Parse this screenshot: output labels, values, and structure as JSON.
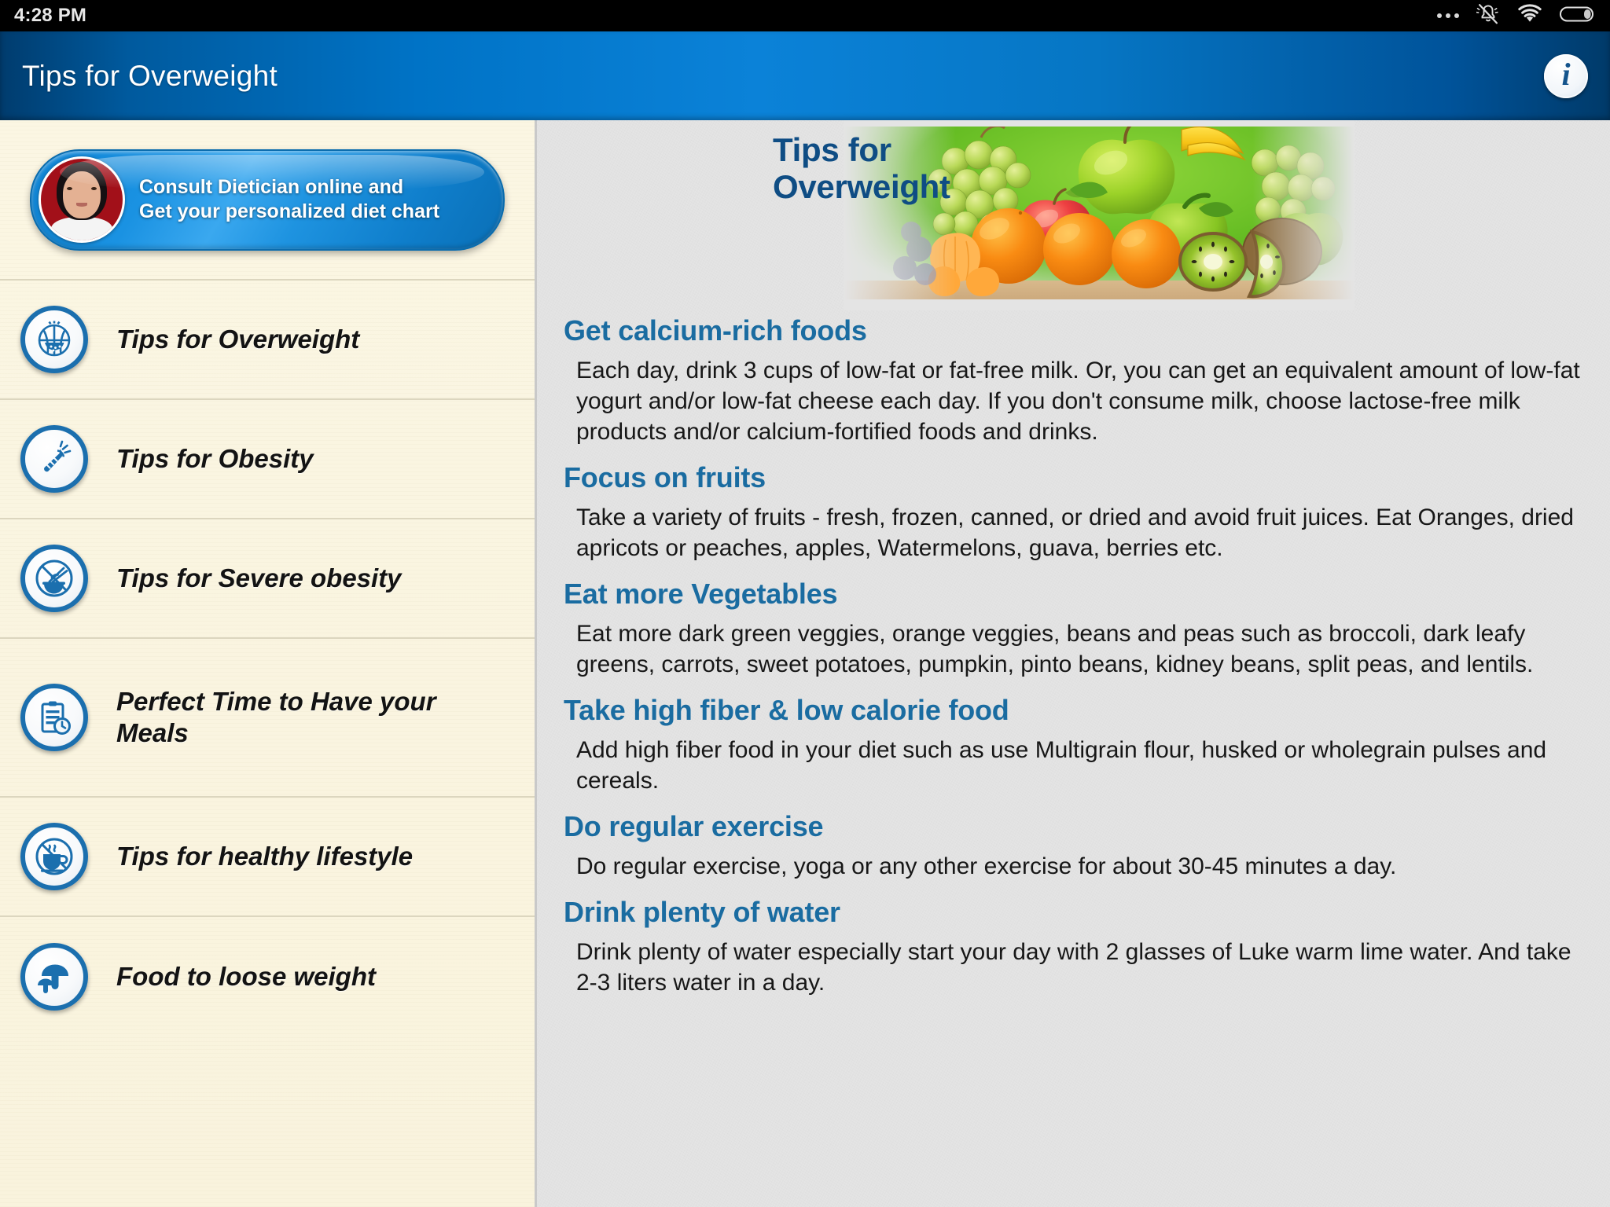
{
  "statusbar": {
    "time": "4:28 PM",
    "icons": [
      "more-dots-icon",
      "vibrate-off-icon",
      "wifi-icon",
      "battery-icon"
    ]
  },
  "appbar": {
    "title": "Tips for Overweight",
    "info_icon": "info-icon",
    "info_label": "i"
  },
  "sidebar": {
    "banner": {
      "line1": "Consult Dietician online and",
      "line2": "Get your personalized diet chart",
      "avatar": "dietician-photo"
    },
    "items": [
      {
        "label": "Tips for Overweight",
        "icon": "watermelon-icon"
      },
      {
        "label": "Tips for Obesity",
        "icon": "carrot-icon"
      },
      {
        "label": "Tips for Severe obesity",
        "icon": "no-noodles-icon"
      },
      {
        "label": "Perfect Time to Have your Meals",
        "icon": "clipboard-clock-icon"
      },
      {
        "label": "Tips for healthy lifestyle",
        "icon": "no-coffee-icon"
      },
      {
        "label": "Food to loose weight",
        "icon": "mushroom-icon"
      }
    ]
  },
  "main": {
    "hero": {
      "title": "Tips for\nOverweight",
      "image": "assorted-fruits-photo"
    },
    "sections": [
      {
        "heading": "Get calcium-rich foods",
        "body": "Each day, drink 3 cups of low-fat or fat-free milk. Or, you can get an equivalent amount of low-fat yogurt and/or low-fat cheese each day. If you don't consume milk, choose lactose-free milk products and/or calcium-fortified foods and drinks."
      },
      {
        "heading": "Focus on fruits",
        "body": "Take a variety of fruits - fresh, frozen, canned, or dried and avoid fruit juices. Eat Oranges, dried apricots or peaches, apples, Watermelons, guava, berries etc."
      },
      {
        "heading": "Eat more Vegetables",
        "body": "Eat more dark green veggies, orange veggies, beans and peas such as broccoli, dark leafy greens, carrots, sweet potatoes, pumpkin, pinto beans, kidney beans, split peas, and lentils."
      },
      {
        "heading": "Take high fiber & low calorie food",
        "body": "Add high fiber food in your diet such as use Multigrain flour, husked or wholegrain pulses and cereals."
      },
      {
        "heading": "Do regular exercise",
        "body": "Do regular exercise, yoga or any other exercise for about 30-45 minutes a day."
      },
      {
        "heading": "Drink plenty of water",
        "body": "Drink plenty of water especially start your day with 2 glasses of Luke warm lime water. And take 2-3 liters water in a day."
      }
    ]
  },
  "colors": {
    "status_bg": "#000000",
    "appbar_blue": "#0b82d8",
    "sidebar_cream": "#fbf6e3",
    "main_gray": "#e4e4e4",
    "heading_blue": "#1a6ca1",
    "icon_blue": "#1b6fae"
  }
}
